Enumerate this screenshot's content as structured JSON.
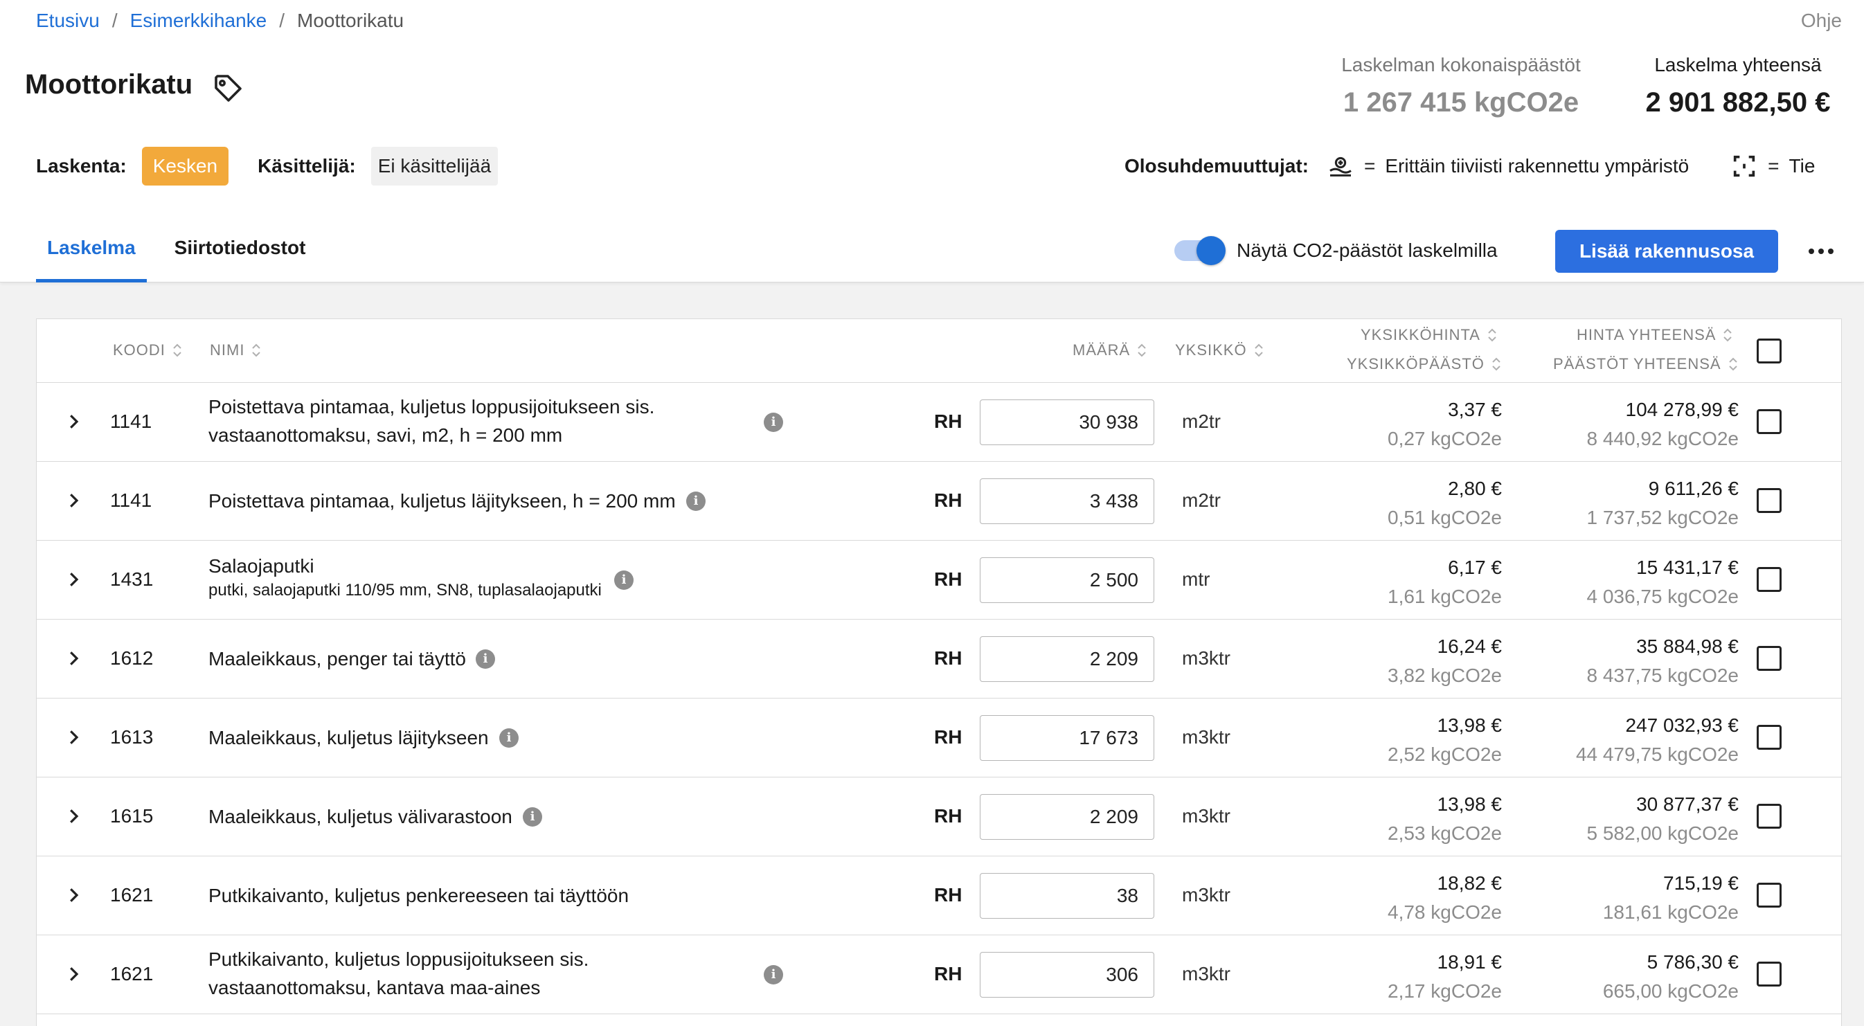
{
  "breadcrumb": {
    "home": "Etusivu",
    "project": "Esimerkkihanke",
    "current": "Moottorikatu",
    "sep": "/"
  },
  "help": "Ohje",
  "title": "Moottorikatu",
  "summary": {
    "emissions_label": "Laskelman kokonaispäästöt",
    "emissions_value": "1 267 415 kgCO2e",
    "total_label": "Laskelma yhteensä",
    "total_value": "2 901 882,50 €"
  },
  "status": {
    "calc_label": "Laskenta:",
    "calc_value": "Kesken",
    "handler_label": "Käsittelijä:",
    "handler_value": "Ei käsittelijää"
  },
  "conditions": {
    "label": "Olosuhdemuuttujat:",
    "eq": "=",
    "area": "Erittäin tiiviisti rakennettu ympäristö",
    "type": "Tie"
  },
  "tabs": {
    "calc": "Laskelma",
    "transfer": "Siirtotiedostot"
  },
  "toggle_label": "Näytä CO2-päästöt laskelmilla",
  "toggle_on": true,
  "add_button": "Lisää rakennusosa",
  "columns": {
    "code": "KOODI",
    "name": "NIMI",
    "qty": "MÄÄRÄ",
    "unit": "YKSIKKÖ",
    "unit_price": "YKSIKKÖHINTA",
    "unit_emission": "YKSIKKÖPÄÄSTÖ",
    "total_price": "HINTA YHTEENSÄ",
    "total_emission": "PÄÄSTÖT YHTEENSÄ"
  },
  "rows": [
    {
      "code": "1141",
      "name1": "Poistettava pintamaa, kuljetus loppusijoitukseen sis.",
      "name2": "vastaanottomaksu, savi, m2, h = 200 mm",
      "tag": "RH",
      "qty": "30 938",
      "unit": "m2tr",
      "unit_price": "3,37 €",
      "unit_emission": "0,27 kgCO2e",
      "total_price": "104 278,99 €",
      "total_emission": "8 440,92 kgCO2e"
    },
    {
      "code": "1141",
      "name1": "Poistettava pintamaa, kuljetus läjitykseen, h = 200 mm",
      "tag": "RH",
      "qty": "3 438",
      "unit": "m2tr",
      "unit_price": "2,80 €",
      "unit_emission": "0,51 kgCO2e",
      "total_price": "9 611,26 €",
      "total_emission": "1 737,52 kgCO2e"
    },
    {
      "code": "1431",
      "name1": "Salaojaputki",
      "sub": "putki, salaojaputki 110/95 mm, SN8, tuplasalaojaputki",
      "tag": "RH",
      "qty": "2 500",
      "unit": "mtr",
      "unit_price": "6,17 €",
      "unit_emission": "1,61 kgCO2e",
      "total_price": "15 431,17 €",
      "total_emission": "4 036,75 kgCO2e"
    },
    {
      "code": "1612",
      "name1": "Maaleikkaus, penger tai täyttö",
      "tag": "RH",
      "qty": "2 209",
      "unit": "m3ktr",
      "unit_price": "16,24 €",
      "unit_emission": "3,82 kgCO2e",
      "total_price": "35 884,98 €",
      "total_emission": "8 437,75 kgCO2e"
    },
    {
      "code": "1613",
      "name1": "Maaleikkaus, kuljetus läjitykseen",
      "tag": "RH",
      "qty": "17 673",
      "unit": "m3ktr",
      "unit_price": "13,98 €",
      "unit_emission": "2,52 kgCO2e",
      "total_price": "247 032,93 €",
      "total_emission": "44 479,75 kgCO2e"
    },
    {
      "code": "1615",
      "name1": "Maaleikkaus, kuljetus välivarastoon",
      "tag": "RH",
      "qty": "2 209",
      "unit": "m3ktr",
      "unit_price": "13,98 €",
      "unit_emission": "2,53 kgCO2e",
      "total_price": "30 877,37 €",
      "total_emission": "5 582,00 kgCO2e"
    },
    {
      "code": "1621",
      "name1": "Putkikaivanto, kuljetus penkereeseen tai täyttöön",
      "tag": "RH",
      "qty": "38",
      "unit": "m3ktr",
      "unit_price": "18,82 €",
      "unit_emission": "4,78 kgCO2e",
      "total_price": "715,19 €",
      "total_emission": "181,61 kgCO2e"
    },
    {
      "code": "1621",
      "name1": "Putkikaivanto, kuljetus loppusijoitukseen sis.",
      "name2": "vastaanottomaksu, kantava maa-aines",
      "tag": "RH",
      "qty": "306",
      "unit": "m3ktr",
      "unit_price": "18,91 €",
      "unit_emission": "2,17 kgCO2e",
      "total_price": "5 786,30 €",
      "total_emission": "665,00 kgCO2e"
    }
  ],
  "colors": {
    "accent": "#2c6fe0",
    "status_kesken": "#f2a93b",
    "muted": "#8c8c8c"
  },
  "icons": {
    "tag": "tag-icon",
    "info": "info-icon",
    "expand": "chevron-right-icon",
    "area": "urban-area-icon",
    "road": "road-icon",
    "more": "more-horizontal-icon",
    "sort": "sort-icon"
  }
}
